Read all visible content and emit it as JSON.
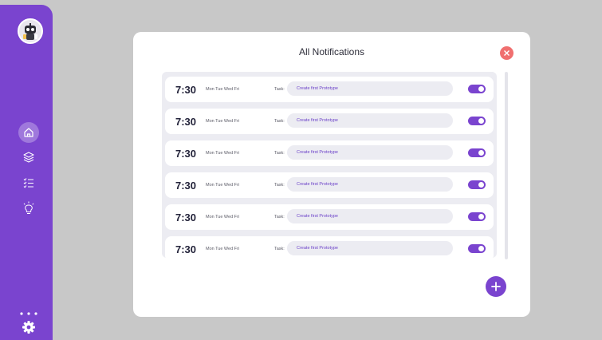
{
  "sidebar": {
    "nav": [
      {
        "name": "home-icon",
        "active": true
      },
      {
        "name": "layers-icon",
        "active": false
      },
      {
        "name": "checklist-icon",
        "active": false
      },
      {
        "name": "lightbulb-icon",
        "active": false
      }
    ],
    "bottom": [
      "more-dots-icon",
      "gear-icon"
    ]
  },
  "modal": {
    "title": "All Notifications",
    "close_icon": "close-icon",
    "add_icon": "plus-icon"
  },
  "notifications": [
    {
      "time": "7:30",
      "days": "Mon Tue Wed Fri",
      "task_label": "Task:",
      "task": "Create first Prototype",
      "enabled": true
    },
    {
      "time": "7:30",
      "days": "Mon Tue Wed Fri",
      "task_label": "Task:",
      "task": "Create first Prototype",
      "enabled": true
    },
    {
      "time": "7:30",
      "days": "Mon Tue Wed Fri",
      "task_label": "Task:",
      "task": "Create first Prototype",
      "enabled": true
    },
    {
      "time": "7:30",
      "days": "Mon Tue Wed Fri",
      "task_label": "Task:",
      "task": "Create first Prototype",
      "enabled": true
    },
    {
      "time": "7:30",
      "days": "Mon Tue Wed Fri",
      "task_label": "Task:",
      "task": "Create first Prototype",
      "enabled": true
    },
    {
      "time": "7:30",
      "days": "Mon Tue Wed Fri",
      "task_label": "Task:",
      "task": "Create first Prototype",
      "enabled": true
    }
  ],
  "colors": {
    "accent": "#7a44cf",
    "background": "#c8c8c8",
    "close": "#f06f6f"
  }
}
